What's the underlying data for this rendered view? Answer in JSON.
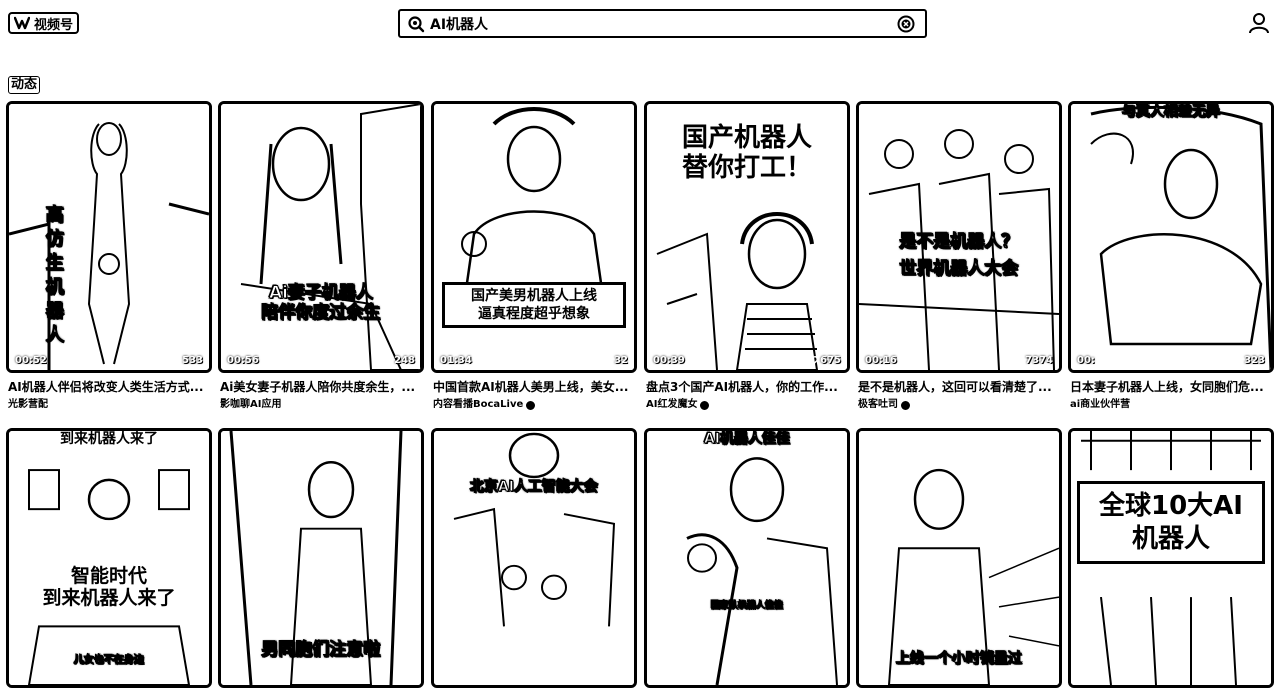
{
  "header": {
    "logo_text": "视频号",
    "search_value": "AI机器人"
  },
  "section": {
    "label": "动态"
  },
  "row1": [
    {
      "overlay": "高仿生机器人",
      "caption": "AI机器人伴侣将改变人类生活方式...",
      "author": "光影营配",
      "duration": "00:52",
      "likes": "533",
      "verified": false
    },
    {
      "overlay": "Ai妻子机器人\n陪伴你度过余生",
      "caption": "Ai美女妻子机器人陪你共度余生，...",
      "author": "影咖聊AI应用",
      "duration": "00:56",
      "likes": "248",
      "verified": false
    },
    {
      "overlay": "国产美男机器人上线\n逼真程度超乎想象",
      "caption": "中国首款AI机器人美男上线，美女...",
      "author": "内容看播BocaLive",
      "duration": "01:34",
      "likes": "32",
      "verified": true
    },
    {
      "overlay": "国产机器人\n替你打工！",
      "caption": "盘点3个国产AI机器人，你的工作...",
      "author": "AI红发魔女",
      "duration": "00:39",
      "likes": "675",
      "verified": true
    },
    {
      "overlay": "是不是机器人？\n世界机器人大会",
      "caption": "是不是机器人，这回可以看清楚了...",
      "author": "极客吐司",
      "duration": "00:16",
      "likes": "7374",
      "verified": true
    },
    {
      "overlay": "与真人相差无异",
      "caption": "日本妻子机器人上线，女同胞们危...",
      "author": "ai商业伙伴营",
      "duration": "00:",
      "likes": "323",
      "verified": false
    }
  ],
  "row2": [
    {
      "overlay_top": "到来机器人来了",
      "overlay": "智能时代\n到来机器人来了",
      "subtitle": "儿女也不在身边"
    },
    {
      "overlay": "男同胞们注意啦"
    },
    {
      "overlay": "北京AI人工智能大会"
    },
    {
      "overlay_top": "AI机器人佳佳",
      "subtitle": "国家队机器人佳佳"
    },
    {
      "overlay": "上线一个小时销量过"
    },
    {
      "overlay": "全球10大AI\n机器人"
    }
  ]
}
